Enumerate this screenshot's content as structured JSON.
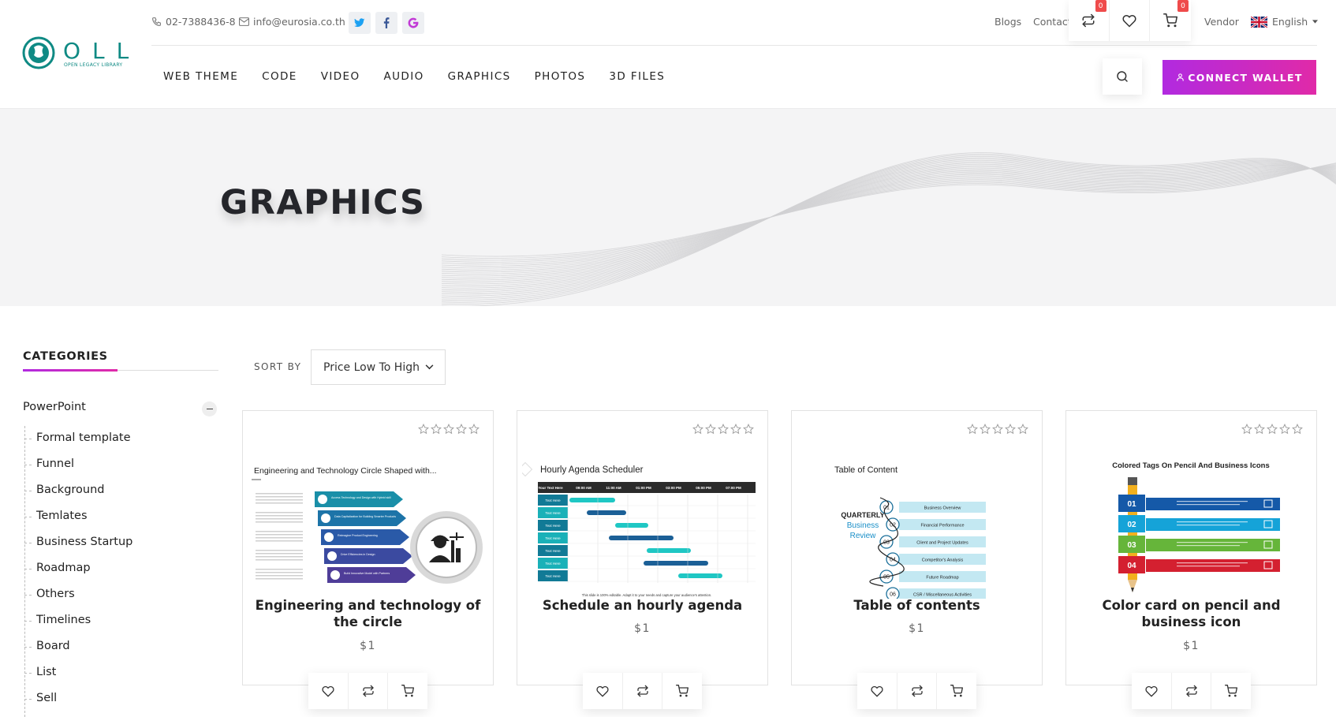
{
  "brand": {
    "name": "OLL",
    "tagline": "OPEN LEGACY LIBRARY",
    "color": "#0f8a84"
  },
  "topbar": {
    "phone": "02-7388436-8",
    "email": "info@eurosia.co.th",
    "social": [
      "twitter-icon",
      "facebook-icon",
      "google-icon"
    ],
    "links": {
      "blogs": "Blogs",
      "contact": "Contact",
      "vendor": "Vendor"
    },
    "compare_count": "0",
    "cart_count": "0",
    "language": "English"
  },
  "nav": {
    "items": [
      "WEB THEME",
      "CODE",
      "VIDEO",
      "AUDIO",
      "GRAPHICS",
      "PHOTOS",
      "3D FILES"
    ]
  },
  "wallet_button": "CONNECT WALLET",
  "accent": {
    "start": "#b12ae0",
    "end": "#e02aa8"
  },
  "hero": {
    "title": "GRAPHICS"
  },
  "sidebar": {
    "title": "CATEGORIES",
    "parent": "PowerPoint",
    "items": [
      "Formal template",
      "Funnel",
      "Background",
      "Temlates",
      "Business Startup",
      "Roadmap",
      "Others",
      "Timelines",
      "Board",
      "List",
      "Sell"
    ]
  },
  "sort": {
    "label": "SORT BY",
    "value": "Price Low To High"
  },
  "products": [
    {
      "title": "Engineering and technology of the circle",
      "price": "$1",
      "thumb_title": "Engineering and Technology Circle Shaped with...",
      "thumb_items": [
        "Access Technology and Design with Hybrid skill",
        "Data Capitalization for Building Smarter Products",
        "Reimagine Product Engineering",
        "Drive Efficiencies in Design",
        "Build Innovative Model with Partners"
      ]
    },
    {
      "title": "Schedule an hourly agenda",
      "price": "$1",
      "thumb_title": "Hourly Agenda Scheduler",
      "thumb_headers": [
        "Your Text Here",
        "09:00 AM",
        "11:00 AM",
        "01:00 PM",
        "03:00 PM",
        "05:00 PM",
        "07:00 PM"
      ],
      "thumb_row_label": "Text Here",
      "thumb_footer": "This slide is 100% editable. Adapt it to your needs and capture your audience's attention."
    },
    {
      "title": "Table of contents",
      "price": "$1",
      "thumb_title": "Table of Content",
      "thumb_side": [
        "QUARTERLY",
        "Business",
        "Review"
      ],
      "thumb_items": [
        "Business Overview",
        "Financial Performance",
        "Client and Project Updates",
        "Competitor's Analysis",
        "Future Roadmap",
        "CSR / Miscellaneous Activities"
      ],
      "thumb_numbers": [
        "01",
        "02",
        "03",
        "04",
        "05",
        "06"
      ]
    },
    {
      "title": "Color card on pencil and business icon",
      "price": "$1",
      "thumb_title": "Colored Tags On Pencil And Business Icons",
      "thumb_numbers": [
        "01",
        "02",
        "03",
        "04"
      ],
      "thumb_labels": [
        "Your Text Here",
        "Put Text Here",
        "Your Text Here",
        "Put Text Here"
      ]
    }
  ]
}
